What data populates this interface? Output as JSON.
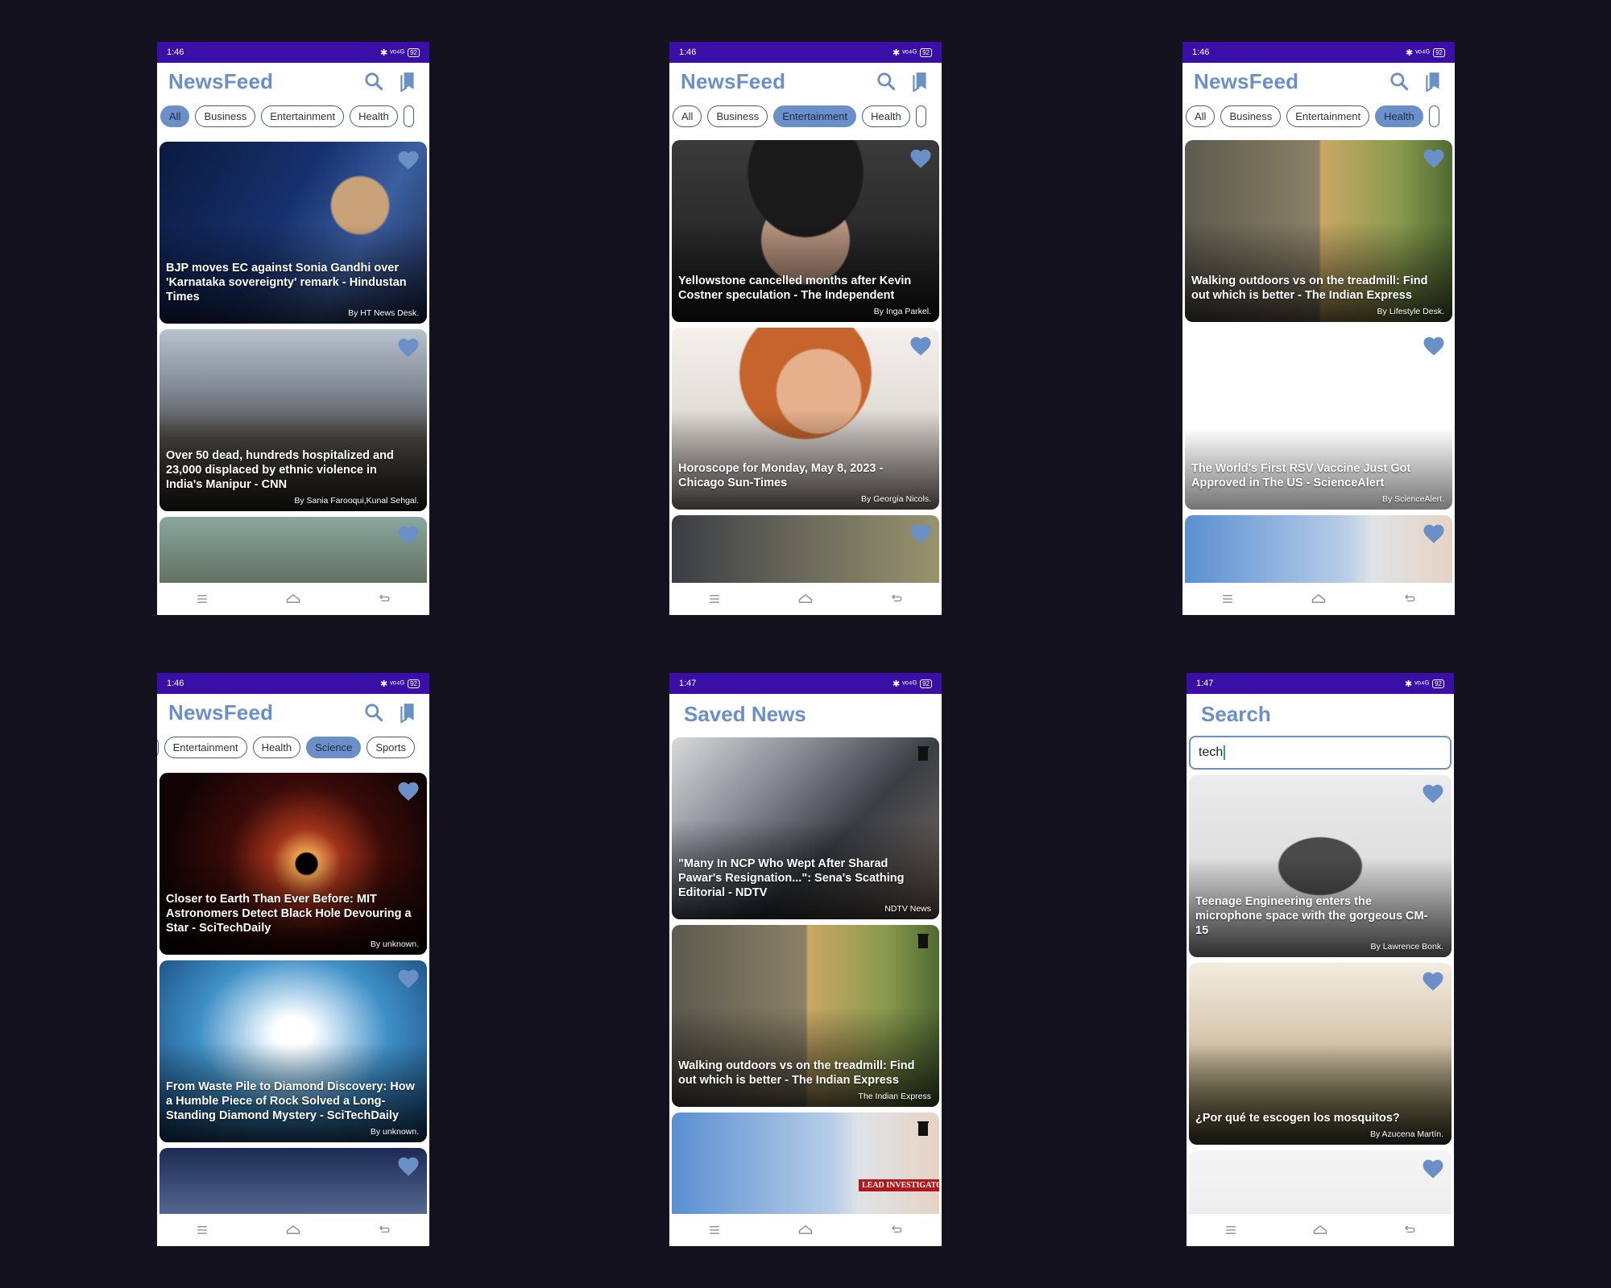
{
  "status": {
    "time1": "1:46",
    "time2": "1:47",
    "left_icons": "✆ ● ···",
    "right_icons": "✱ ᵛᵒ⁴ᴳ",
    "battery": "92"
  },
  "app_title": "NewsFeed",
  "chips_main": [
    "All",
    "Business",
    "Entertainment",
    "Health"
  ],
  "chips_science": [
    "Entertainment",
    "Health",
    "Science",
    "Sports"
  ],
  "saved_title": "Saved News",
  "search_title": "Search",
  "search_value": "tech",
  "colors": {
    "accent": "#6b8fc7",
    "statusbar": "#3a0fa8",
    "chip_border": "#48598a",
    "bg": "#14121f"
  },
  "icons": [
    "search-icon",
    "bookmark-icon",
    "heart-icon",
    "menu-icon",
    "home-icon",
    "back-icon",
    "trash-icon"
  ],
  "screens": {
    "all": [
      {
        "headline": "BJP moves EC against Sonia Gandhi over 'Karnataka sovereignty' remark - Hindustan Times",
        "author": "By HT News Desk."
      },
      {
        "headline": "Over 50 dead, hundreds hospitalized and 23,000 displaced by ethnic violence in India's Manipur - CNN",
        "author": "By Sania Farooqui,Kunal Sehgal."
      },
      {
        "headline": "",
        "author": ""
      }
    ],
    "entertainment": [
      {
        "headline": "Yellowstone cancelled months after Kevin Costner speculation - The Independent",
        "author": "By Inga Parkel."
      },
      {
        "headline": "Horoscope for Monday, May 8, 2023 - Chicago Sun-Times",
        "author": "By Georgia Nicols."
      },
      {
        "headline": "",
        "author": ""
      }
    ],
    "health": [
      {
        "headline": "Walking outdoors vs on the treadmill: Find out which is better - The Indian Express",
        "author": "By Lifestyle Desk."
      },
      {
        "headline": "The World's First RSV Vaccine Just Got Approved in The US - ScienceAlert",
        "author": "By ScienceAlert."
      },
      {
        "headline": "",
        "author": ""
      }
    ],
    "science": [
      {
        "headline": "Closer to Earth Than Ever Before: MIT Astronomers Detect Black Hole Devouring a Star - SciTechDaily",
        "author": "By unknown."
      },
      {
        "headline": "From Waste Pile to Diamond Discovery: How a Humble Piece of Rock Solved a Long-Standing Diamond Mystery - SciTechDaily",
        "author": "By unknown."
      },
      {
        "headline": "",
        "author": ""
      }
    ],
    "saved": [
      {
        "headline": "\"Many In NCP Who Wept After Sharad Pawar's Resignation...\": Sena's Scathing Editorial - NDTV",
        "author": "NDTV News"
      },
      {
        "headline": "Walking outdoors vs on the treadmill: Find out which is better - The Indian Express",
        "author": "The Indian Express"
      },
      {
        "headline": "",
        "author": ""
      }
    ],
    "search": [
      {
        "headline": "Teenage Engineering enters the microphone space with the gorgeous CM-15",
        "author": "By Lawrence Bonk."
      },
      {
        "headline": "¿Por qué te escogen los mosquitos?",
        "author": "By Azucena Martín."
      },
      {
        "headline": "",
        "author": ""
      }
    ]
  },
  "badge_text": "LEAD INVESTIGATO"
}
